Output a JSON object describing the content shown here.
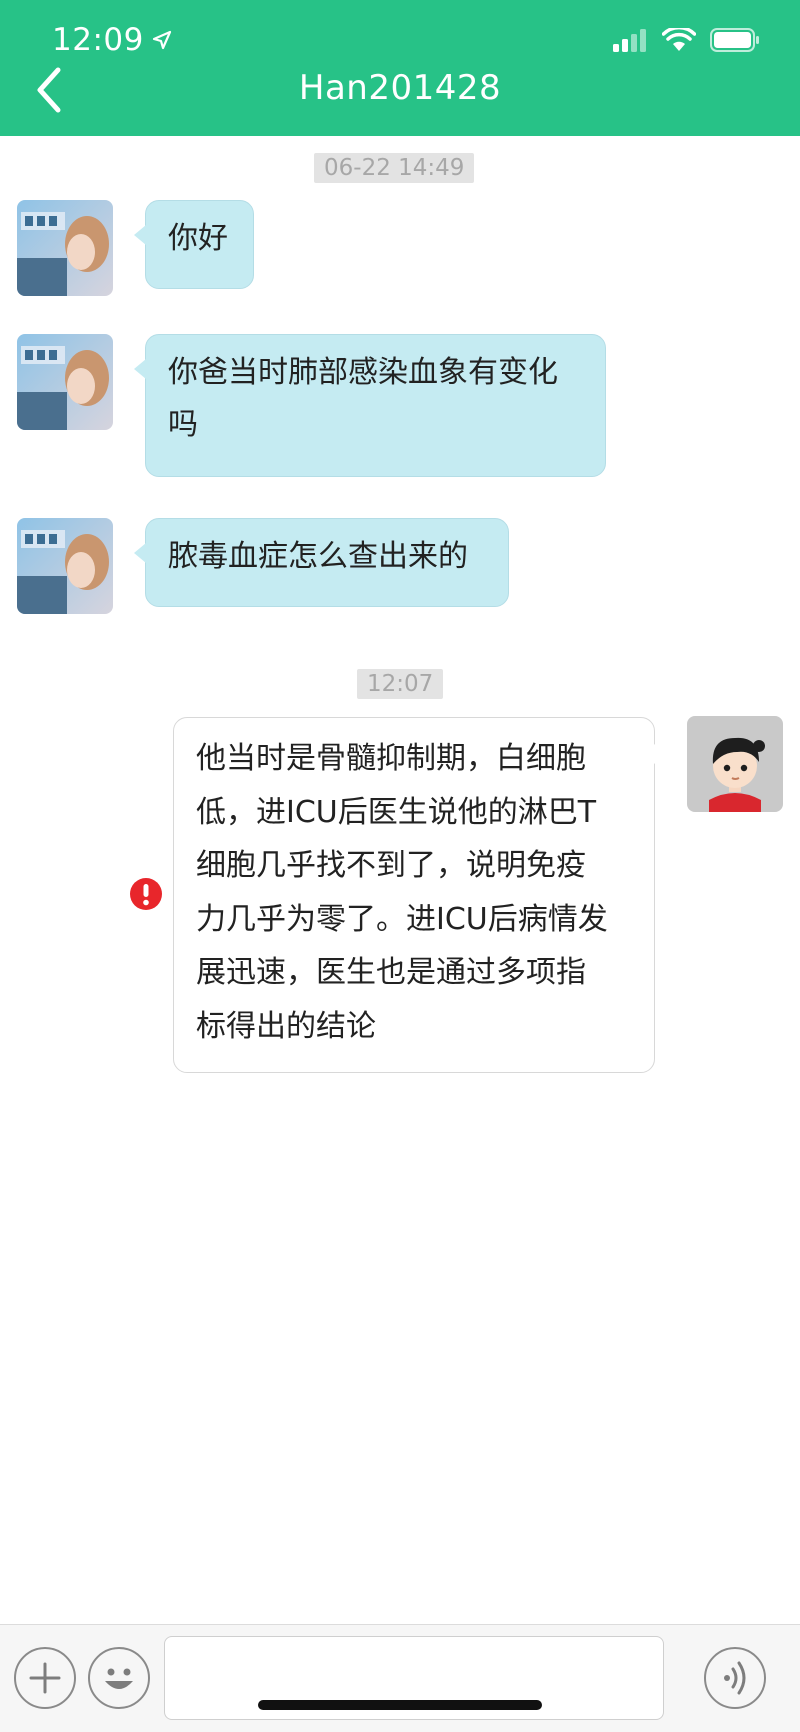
{
  "status_bar": {
    "time": "12:09"
  },
  "header": {
    "title": "Han201428"
  },
  "messages": [
    {
      "type": "timestamp",
      "text": "06-22 14:49"
    },
    {
      "type": "incoming",
      "text": "你好"
    },
    {
      "type": "incoming",
      "lines": [
        "你爸当时肺部感染血象有变化",
        "吗"
      ]
    },
    {
      "type": "incoming",
      "text": "脓毒血症怎么查出来的"
    },
    {
      "type": "timestamp",
      "text": "12:07"
    },
    {
      "type": "outgoing",
      "status": "send-failed",
      "lines": [
        "他当时是骨髓抑制期，白细胞",
        "低，进ICU后医生说他的淋巴T",
        "细胞几乎找不到了，说明免疫",
        "力几乎为零了。进ICU后病情发",
        "展迅速，医生也是通过多项指",
        "标得出的结论"
      ]
    }
  ],
  "input_bar": {
    "message_value": "",
    "buttons": [
      "add-icon",
      "emoji-icon",
      "voice-icon"
    ]
  },
  "colors": {
    "header": "#27c287",
    "incoming_bubble": "#c5ebf2",
    "outgoing_bubble": "#ffffff",
    "error": "#e8262b"
  }
}
